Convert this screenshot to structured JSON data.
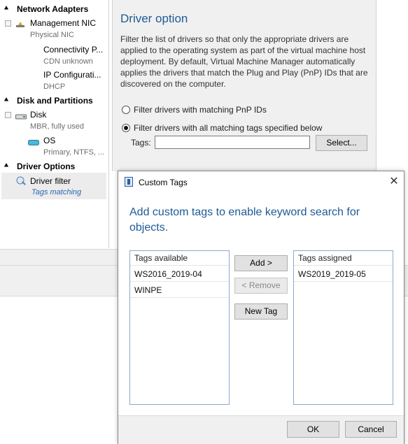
{
  "nav": {
    "sections": [
      {
        "title": "Network Adapters"
      },
      {
        "title": "Disk and Partitions"
      },
      {
        "title": "Driver Options"
      }
    ],
    "management_nic": {
      "label": "Management NIC",
      "sub": "Physical NIC"
    },
    "connectivity": {
      "label": "Connectivity P...",
      "sub": "CDN unknown"
    },
    "ip_config": {
      "label": "IP Configurati...",
      "sub": "DHCP"
    },
    "disk": {
      "label": "Disk",
      "sub": "MBR, fully used"
    },
    "os": {
      "label": "OS",
      "sub": "Primary, NTFS, ..."
    },
    "driver_filter": {
      "label": "Driver filter",
      "sub": "Tags matching"
    }
  },
  "driver_option": {
    "title": "Driver option",
    "description": "Filter the list of drivers so that only the appropriate drivers are applied to the operating system as part of the virtual machine host deployment. By default, Virtual Machine Manager automatically applies the drivers that match the Plug and Play (PnP) IDs that are discovered on the computer.",
    "radio_pnp": "Filter drivers with matching PnP IDs",
    "radio_tags": "Filter drivers with all matching tags specified below",
    "tags_label": "Tags:",
    "tags_value": "",
    "select_button": "Select..."
  },
  "dialog": {
    "title": "Custom Tags",
    "close_glyph": "✕",
    "heading": "Add custom tags to enable keyword search for objects.",
    "available": {
      "header": "Tags available",
      "items": [
        "WS2016_2019-04",
        "WINPE"
      ]
    },
    "assigned": {
      "header": "Tags assigned",
      "items": [
        "WS2019_2019-05"
      ]
    },
    "add_button": "Add >",
    "remove_button": "< Remove",
    "new_tag_button": "New Tag",
    "ok_button": "OK",
    "cancel_button": "Cancel"
  },
  "colors": {
    "accent": "#1e5a96",
    "link_sub": "#2b67b4",
    "selection": "#ececec"
  },
  "icons": {
    "collapse": "chevron-double-up-icon",
    "network": "network-adapter-icon",
    "disk": "disk-icon",
    "partition": "partition-icon",
    "driver": "driver-filter-icon",
    "dialog": "custom-tags-dialog-icon",
    "close": "close-icon"
  }
}
